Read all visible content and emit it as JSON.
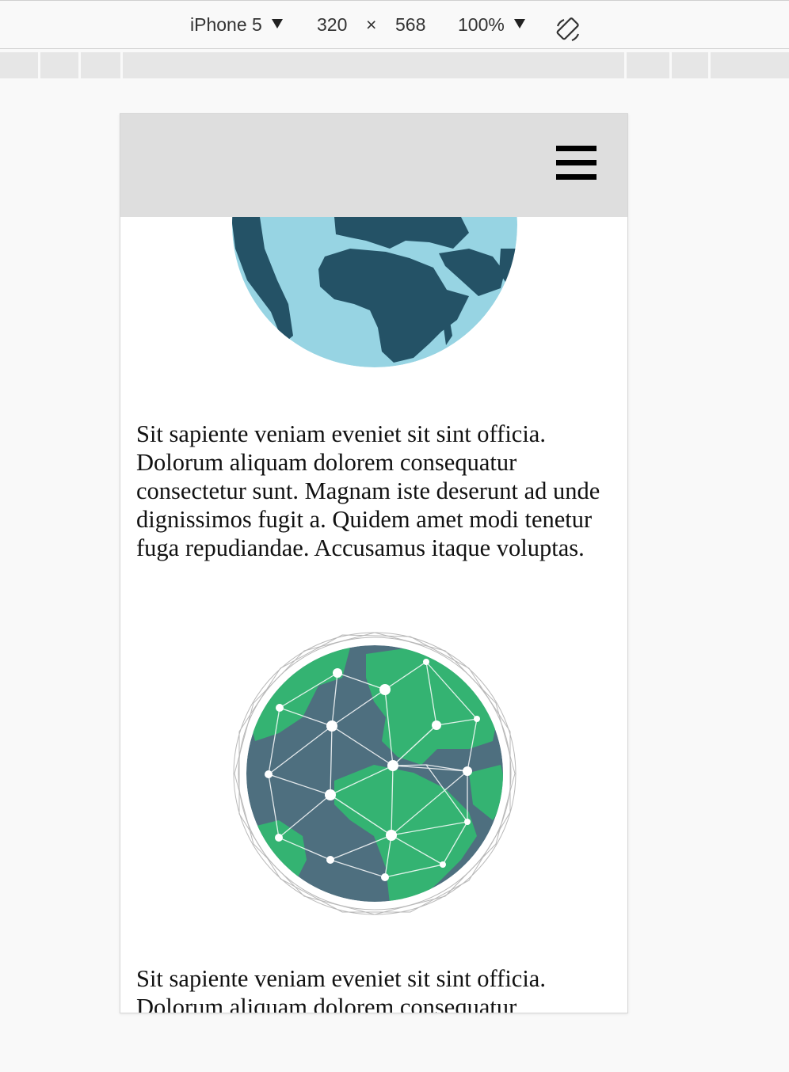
{
  "toolbar": {
    "device": "iPhone 5",
    "width": "320",
    "times": "×",
    "height": "568",
    "zoom": "100%",
    "rotate_icon": "rotate-icon"
  },
  "page": {
    "header": {
      "menu_icon": "hamburger-menu-icon",
      "background": "#dedede"
    },
    "images": [
      {
        "name": "earth-globe-africa",
        "ocean": "#97d4e3",
        "land": "#245266"
      },
      {
        "name": "network-globe-europe-africa",
        "ocean": "#4e6f7f",
        "land": "#34b372",
        "nodes": "#ffffff"
      }
    ],
    "paragraphs": [
      "Sit sapiente veniam eveniet sit sint officia. Dolorum aliquam dolorem consequatur consectetur sunt. Magnam iste deserunt ad unde dignissimos fugit a. Quidem amet modi tenetur fuga repudiandae. Accusamus itaque voluptas.",
      "Sit sapiente veniam eveniet sit sint officia. Dolorum aliquam dolorem consequatur"
    ]
  }
}
